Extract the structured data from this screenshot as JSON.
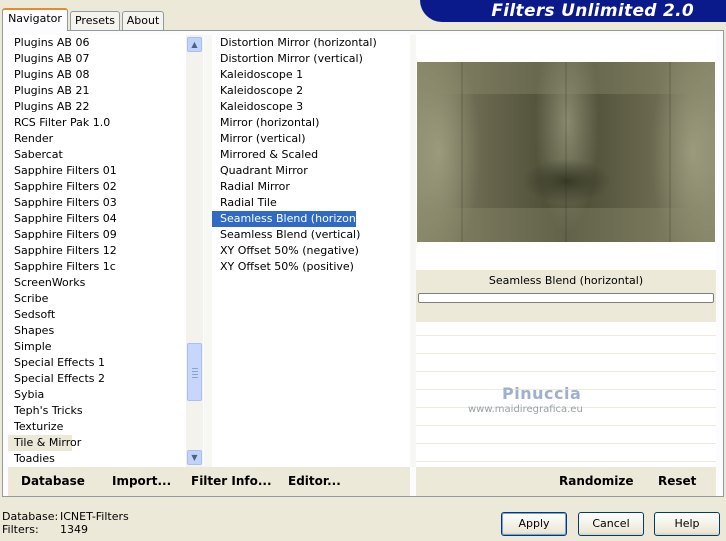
{
  "app": {
    "title": "Filters Unlimited 2.0"
  },
  "tabs": [
    {
      "label": "Navigator",
      "active": true
    },
    {
      "label": "Presets",
      "active": false
    },
    {
      "label": "About",
      "active": false
    }
  ],
  "categories": {
    "items": [
      "Plugins AB 06",
      "Plugins AB 07",
      "Plugins AB 08",
      "Plugins AB 21",
      "Plugins AB 22",
      "RCS Filter Pak 1.0",
      "Render",
      "Sabercat",
      "Sapphire Filters 01",
      "Sapphire Filters 02",
      "Sapphire Filters 03",
      "Sapphire Filters 04",
      "Sapphire Filters 09",
      "Sapphire Filters 12",
      "Sapphire Filters 1c",
      "ScreenWorks",
      "Scribe",
      "Sedsoft",
      "Shapes",
      "Simple",
      "Special Effects 1",
      "Special Effects 2",
      "Sybia",
      "Teph's Tricks",
      "Texturize",
      "Tile & Mirror",
      "Toadies"
    ],
    "selected": "Tile & Mirror"
  },
  "filters": {
    "items": [
      "Distortion Mirror (horizontal)",
      "Distortion Mirror (vertical)",
      "Kaleidoscope 1",
      "Kaleidoscope 2",
      "Kaleidoscope 3",
      "Mirror (horizontal)",
      "Mirror (vertical)",
      "Mirrored & Scaled",
      "Quadrant Mirror",
      "Radial Mirror",
      "Radial Tile",
      "Seamless Blend (horizontal)",
      "Seamless Blend (vertical)",
      "XY Offset 50% (negative)",
      "XY Offset 50% (positive)"
    ],
    "selected": "Seamless Blend (horizontal)"
  },
  "preview": {
    "filter_name": "Seamless Blend (horizontal)",
    "watermark_name": "Pinuccia",
    "watermark_url": "www.maidiregrafica.eu"
  },
  "actions_left": {
    "database": "Database",
    "import": "Import...",
    "filter_info": "Filter Info...",
    "editor": "Editor..."
  },
  "actions_right": {
    "randomize": "Randomize",
    "reset": "Reset"
  },
  "status": {
    "database_label": "Database:",
    "database_value": "ICNET-Filters",
    "filters_label": "Filters:",
    "filters_value": "1349"
  },
  "buttons": {
    "apply": "Apply",
    "cancel": "Cancel",
    "help": "Help"
  },
  "colors": {
    "banner": "#0a1a8a",
    "selection": "#316ac5",
    "dialog_face": "#ece9d8"
  }
}
